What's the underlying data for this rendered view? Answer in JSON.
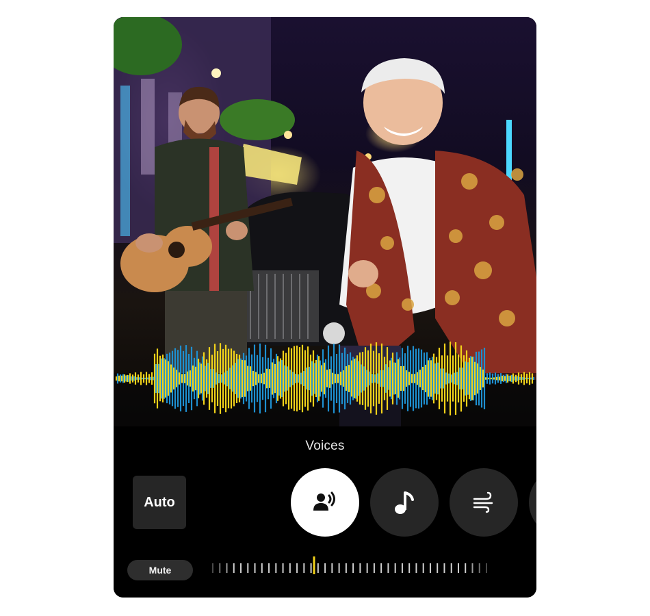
{
  "editor": {
    "mode_label": "Voices",
    "auto_label": "Auto",
    "mute_label": "Mute",
    "categories": [
      {
        "icon": "voice-icon",
        "selected": true
      },
      {
        "icon": "music-note-icon",
        "selected": false
      },
      {
        "icon": "wind-icon",
        "selected": false
      },
      {
        "icon": "more-category-icon",
        "selected": false
      }
    ],
    "level_marker": 0.37
  },
  "colors": {
    "waveform_primary": "#f2d21a",
    "waveform_secondary": "#1e8fd0",
    "panel_background": "#000000",
    "button_background": "#262626",
    "active_button": "#ffffff"
  }
}
